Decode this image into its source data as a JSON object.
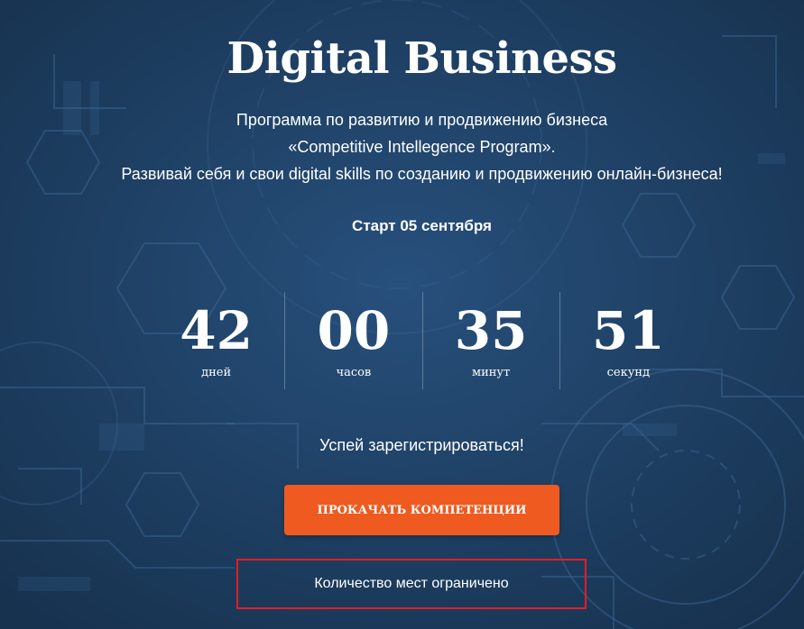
{
  "hero": {
    "title": "Digital Business",
    "subtitle_line1": "Программа по развитию и продвижению бизнеса",
    "subtitle_line2": "«Competitive Intellegence Program».",
    "subtitle_line3": "Развивай себя и свои digital skills по созданию и продвижению онлайн-бизнеса!",
    "start_text": "Старт 05 сентября"
  },
  "countdown": [
    {
      "value": "42",
      "unit": "дней"
    },
    {
      "value": "00",
      "unit": "часов"
    },
    {
      "value": "35",
      "unit": "минут"
    },
    {
      "value": "51",
      "unit": "секунд"
    }
  ],
  "cta": {
    "prompt": "Успей зарегистрироваться!",
    "button_label": "ПРОКАЧАТЬ КОМПЕТЕНЦИИ",
    "limited_note": "Количество мест ограничено"
  },
  "colors": {
    "background": "#1d3d64",
    "button": "#ee5a20",
    "highlight_border": "#e01f26"
  }
}
